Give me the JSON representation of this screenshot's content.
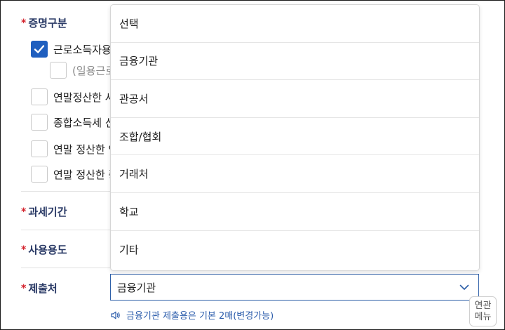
{
  "sections": {
    "proof_type": "증명구분",
    "tax_period": "과세기간",
    "purpose": "사용용도",
    "submit_to": "제출처"
  },
  "checkboxes": [
    {
      "label": "근로소득자용",
      "checked": true
    },
    {
      "label": "(일용근로",
      "checked": false
    },
    {
      "label": "연말정산한 사",
      "checked": false
    },
    {
      "label": "종합소득세 신",
      "checked": false
    },
    {
      "label": "연말 정산한 인",
      "checked": false
    },
    {
      "label": "연말 정산한 종",
      "checked": false
    }
  ],
  "dropdown": {
    "options": [
      "선택",
      "금융기관",
      "관공서",
      "조합/협회",
      "거래처",
      "학교",
      "기타"
    ]
  },
  "select": {
    "value": "금융기관"
  },
  "note": "금융기관 제출용은 기본 2매(변경가능)",
  "related_menu": {
    "line1": "연관",
    "line2": "메뉴"
  },
  "colors": {
    "accent": "#1f5fbf",
    "label": "#2a3a66",
    "required": "#d3202a",
    "note": "#2b5cab"
  }
}
